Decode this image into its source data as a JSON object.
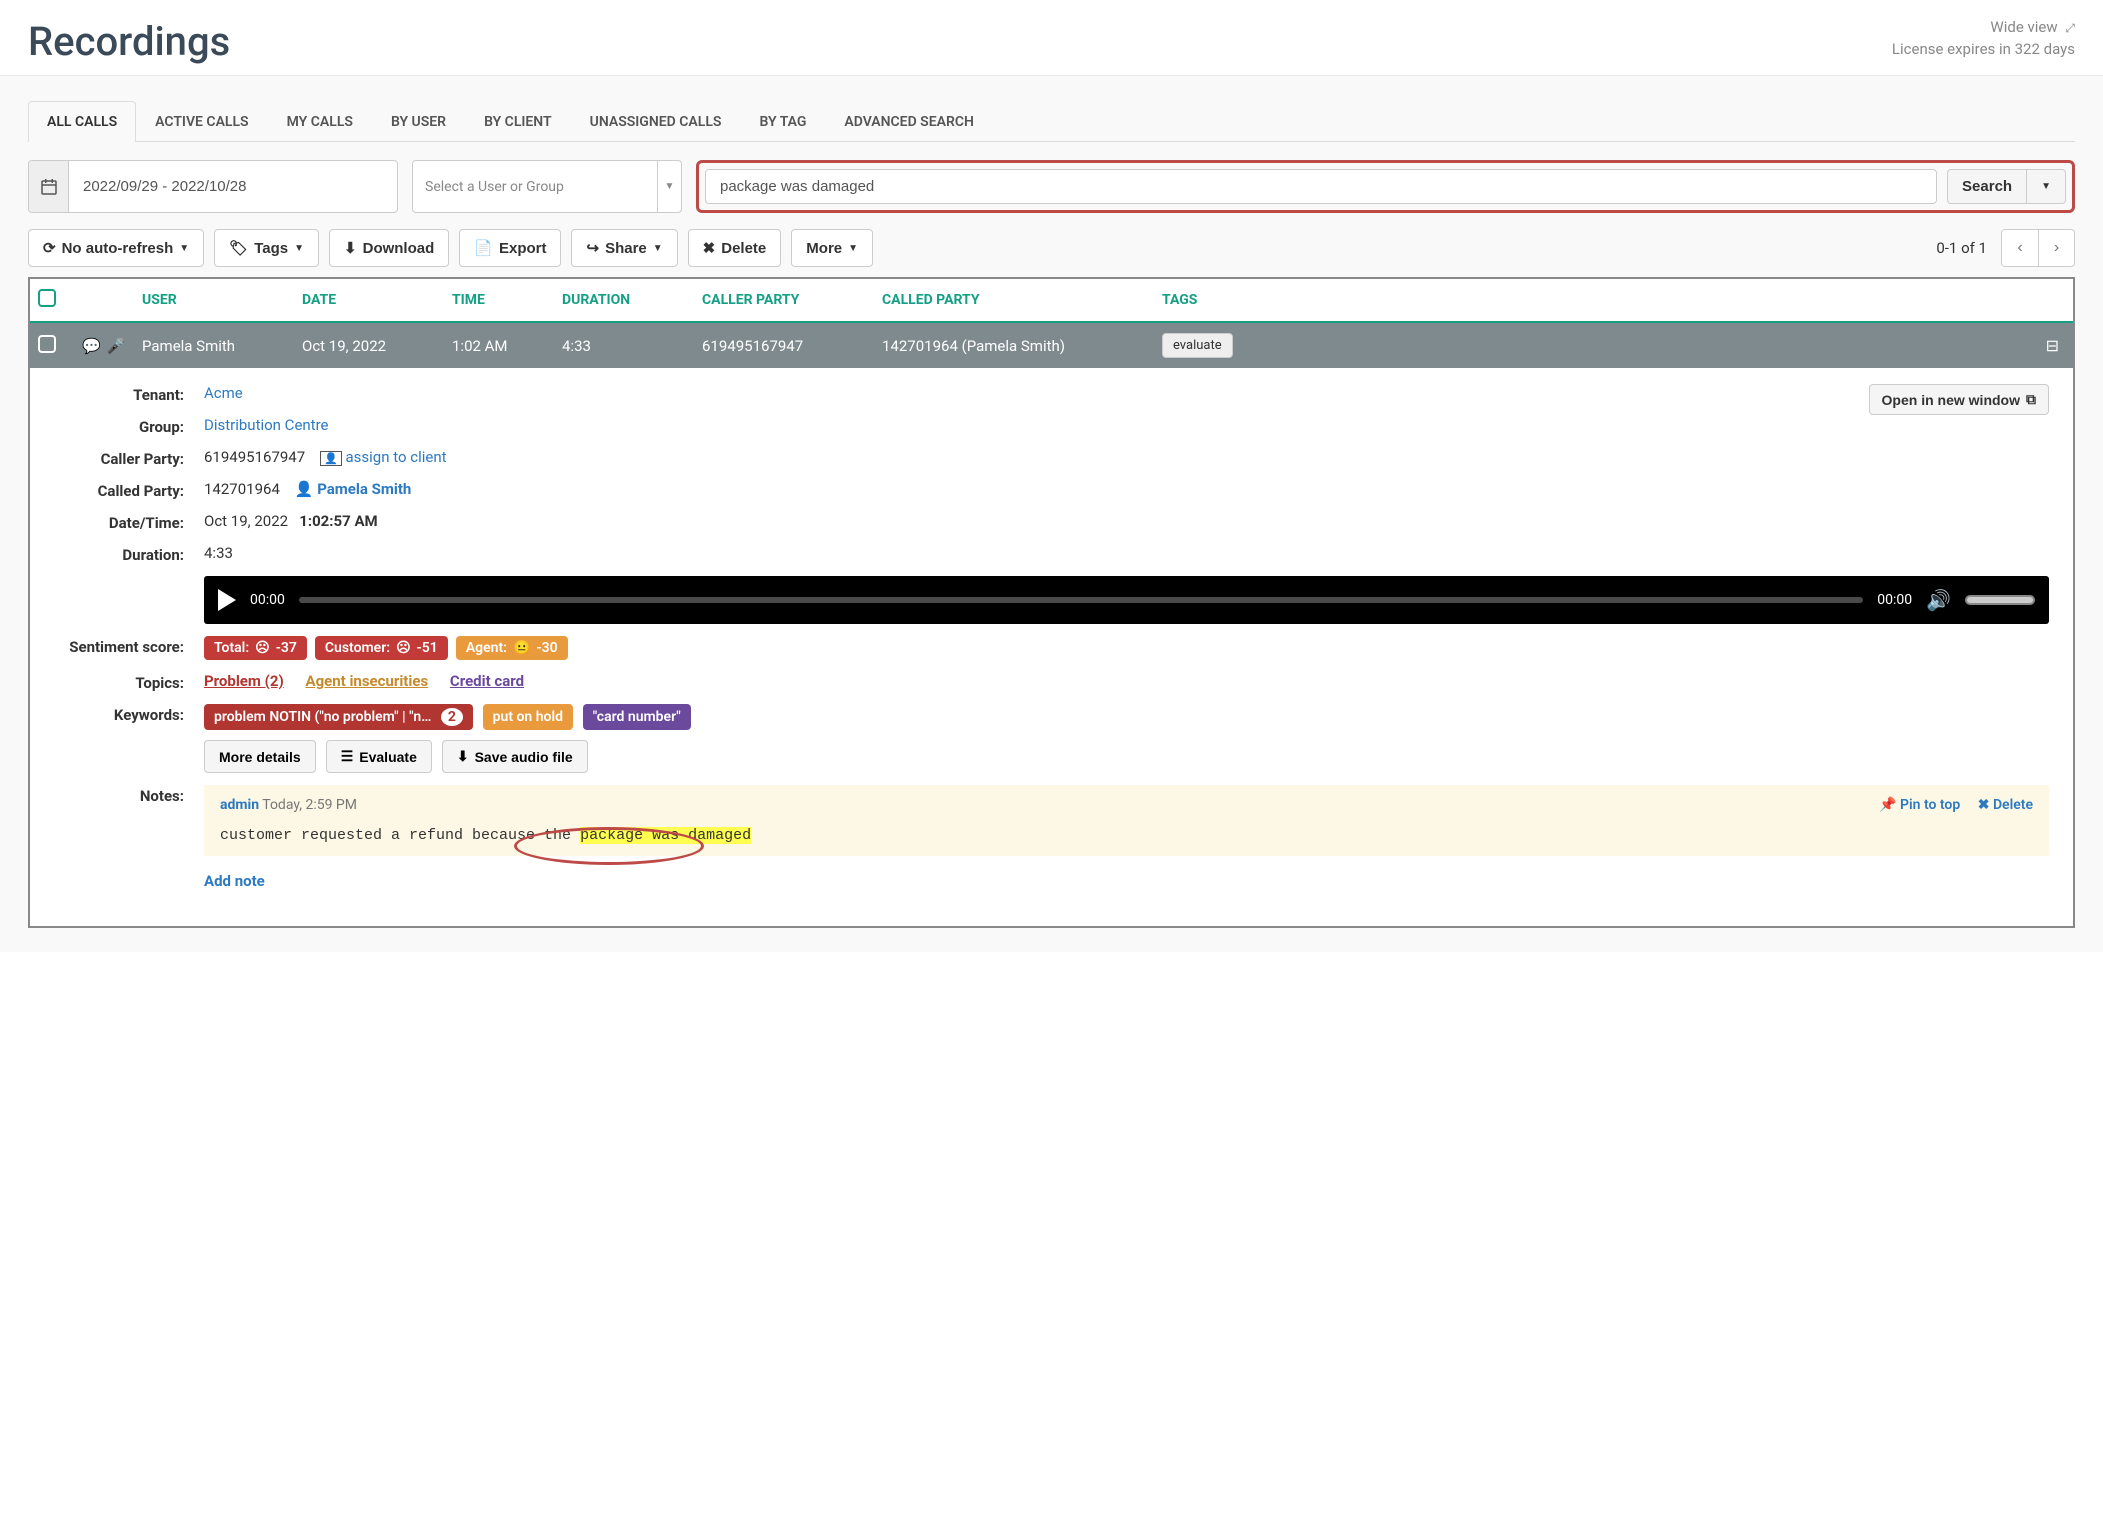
{
  "header": {
    "title": "Recordings",
    "wide_view": "Wide view",
    "license": "License expires in 322 days"
  },
  "tabs": [
    {
      "label": "ALL CALLS",
      "active": true
    },
    {
      "label": "ACTIVE CALLS"
    },
    {
      "label": "MY CALLS"
    },
    {
      "label": "BY USER"
    },
    {
      "label": "BY CLIENT"
    },
    {
      "label": "UNASSIGNED CALLS"
    },
    {
      "label": "BY TAG"
    },
    {
      "label": "ADVANCED SEARCH"
    }
  ],
  "filters": {
    "date_range": "2022/09/29 - 2022/10/28",
    "user_group_placeholder": "Select a User or Group",
    "search_value": "package was damaged",
    "search_label": "Search"
  },
  "toolbar": {
    "refresh": "No auto-refresh",
    "tags": "Tags",
    "download": "Download",
    "export": "Export",
    "share": "Share",
    "delete": "Delete",
    "more": "More",
    "page_info": "0-1 of 1"
  },
  "columns": [
    "USER",
    "DATE",
    "TIME",
    "DURATION",
    "CALLER PARTY",
    "CALLED PARTY",
    "TAGS"
  ],
  "row": {
    "user": "Pamela Smith",
    "date": "Oct 19, 2022",
    "time": "1:02 AM",
    "duration": "4:33",
    "caller": "619495167947",
    "called": "142701964 (Pamela Smith)",
    "tag_btn": "evaluate"
  },
  "detail": {
    "open_new": "Open in new window",
    "tenant_label": "Tenant:",
    "tenant": "Acme",
    "group_label": "Group:",
    "group": "Distribution Centre",
    "caller_label": "Caller Party:",
    "caller": "619495167947",
    "assign_client": "assign to client",
    "called_label": "Called Party:",
    "called_num": "142701964",
    "called_name": "Pamela Smith",
    "datetime_label": "Date/Time:",
    "datetime_date": "Oct 19, 2022",
    "datetime_time": "1:02:57 AM",
    "duration_label": "Duration:",
    "duration": "4:33",
    "audio_cur": "00:00",
    "audio_total": "00:00",
    "sentiment_label": "Sentiment score:",
    "sent_total_lbl": "Total:",
    "sent_total_val": "-37",
    "sent_cust_lbl": "Customer:",
    "sent_cust_val": "-51",
    "sent_agent_lbl": "Agent:",
    "sent_agent_val": "-30",
    "topics_label": "Topics:",
    "topic1": "Problem (2)",
    "topic2": "Agent insecurities",
    "topic3": "Credit card",
    "keywords_label": "Keywords:",
    "kw1": "problem NOTIN (\"no problem\" | \"n…",
    "kw1_count": "2",
    "kw2": "put on hold",
    "kw3": "\"card number\"",
    "more_details": "More details",
    "evaluate": "Evaluate",
    "save_audio": "Save audio file",
    "notes_label": "Notes:",
    "note_author": "admin",
    "note_time": "Today, 2:59 PM",
    "pin": "Pin to top",
    "del": "Delete",
    "note_pre": "customer requested a refund because the ",
    "note_hl": "package was damaged",
    "add_note": "Add note"
  }
}
